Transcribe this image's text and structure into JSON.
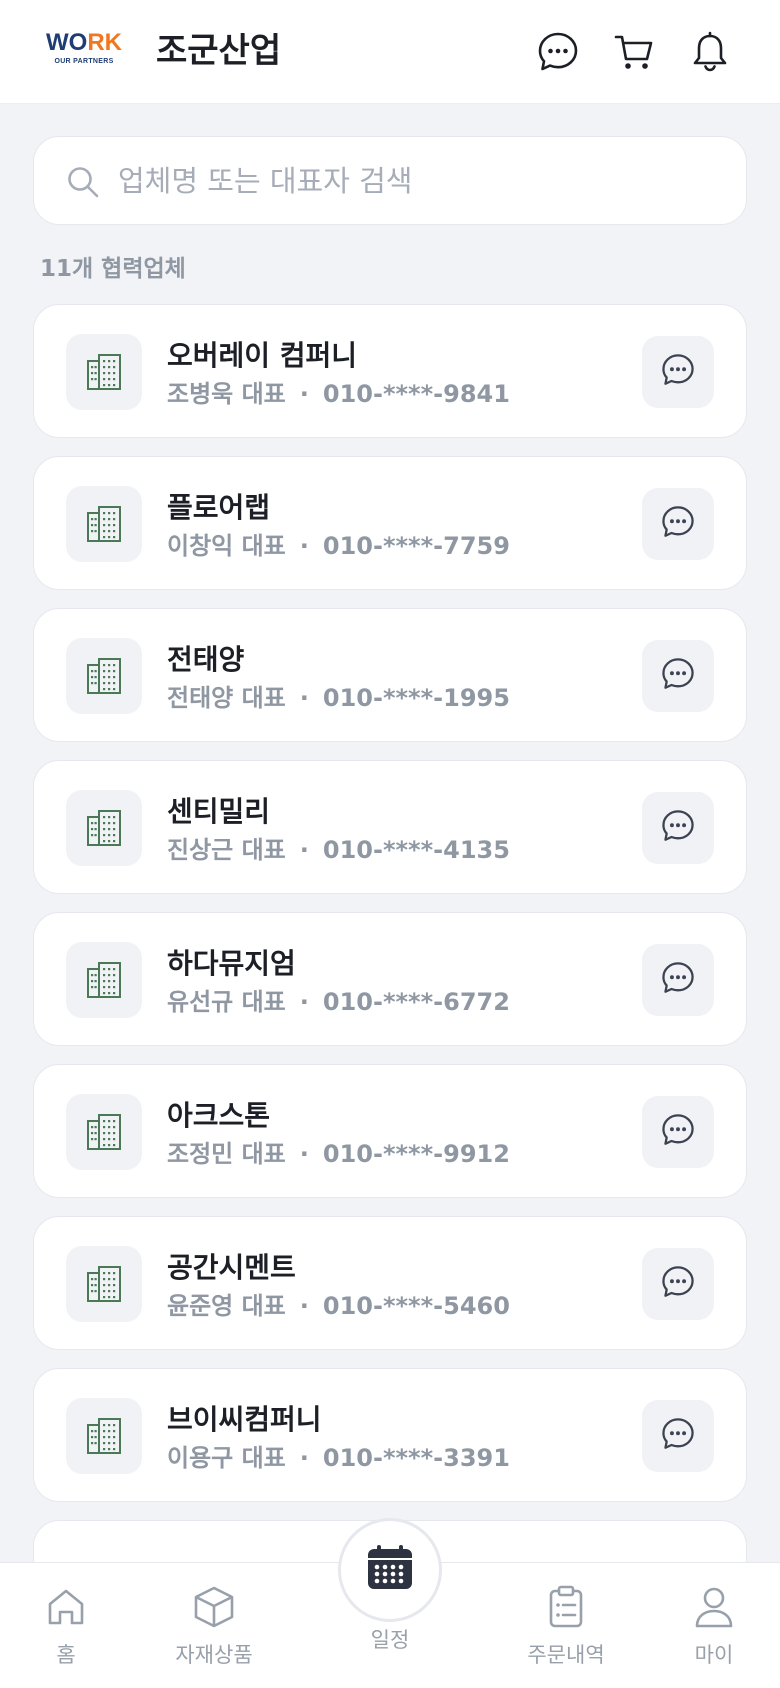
{
  "header": {
    "logo_text_w": "W",
    "logo_text_o": "O",
    "logo_text_rk": "RK",
    "logo_sub": "OUR PARTNERS",
    "title": "조군산업",
    "icons": [
      "chat-icon",
      "cart-icon",
      "bell-icon"
    ]
  },
  "search": {
    "placeholder": "업체명 또는 대표자 검색",
    "value": ""
  },
  "list_count_label": "11개 협력업체",
  "partners": [
    {
      "name": "오버레이 컴퍼니",
      "rep": "조병욱 대표",
      "dot": "·",
      "phone": "010-****-9841"
    },
    {
      "name": "플로어랩",
      "rep": "이창익 대표",
      "dot": "·",
      "phone": "010-****-7759"
    },
    {
      "name": "전태양",
      "rep": "전태양 대표",
      "dot": "·",
      "phone": "010-****-1995"
    },
    {
      "name": "센티밀리",
      "rep": "진상근 대표",
      "dot": "·",
      "phone": "010-****-4135"
    },
    {
      "name": "하다뮤지엄",
      "rep": "유선규 대표",
      "dot": "·",
      "phone": "010-****-6772"
    },
    {
      "name": "아크스톤",
      "rep": "조정민 대표",
      "dot": "·",
      "phone": "010-****-9912"
    },
    {
      "name": "공간시멘트",
      "rep": "윤준영 대표",
      "dot": "·",
      "phone": "010-****-5460"
    },
    {
      "name": "브이씨컴퍼니",
      "rep": "이용구 대표",
      "dot": "·",
      "phone": "010-****-3391"
    }
  ],
  "bottom_nav": {
    "home": "홈",
    "products": "자재상품",
    "schedule": "일정",
    "orders": "주문내역",
    "my": "마이"
  },
  "colors": {
    "background": "#f2f3f7",
    "card": "#ffffff",
    "icon_box": "#f1f2f6",
    "building_icon": "#4a7a55",
    "muted_text": "#8f97a3",
    "logo_orange": "#f07820",
    "logo_navy": "#1f3c73"
  }
}
